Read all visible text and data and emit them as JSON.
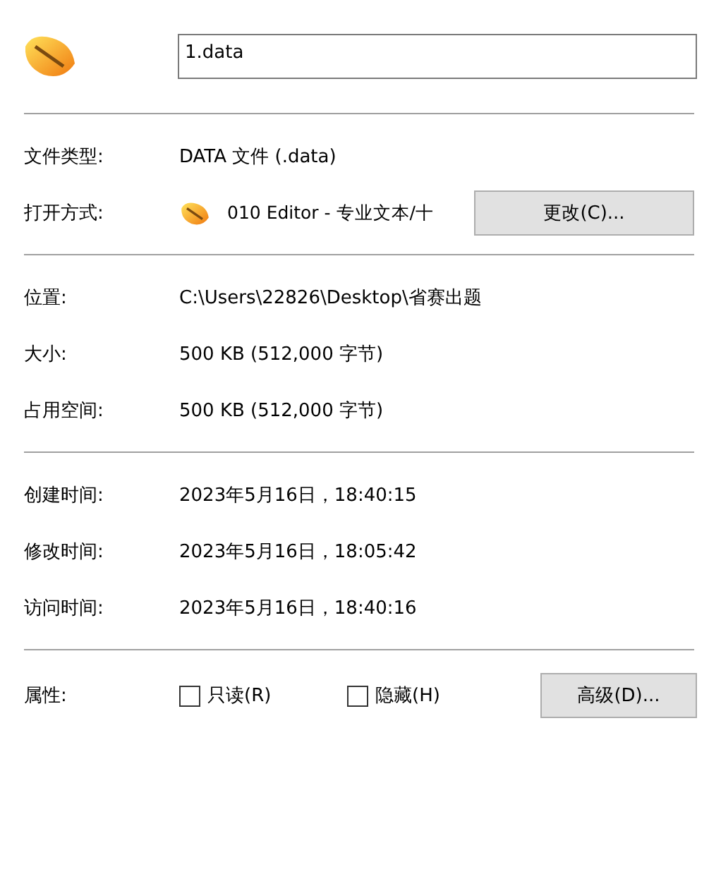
{
  "file_name": "1.data",
  "groups": [
    [
      {
        "kind": "text",
        "label": "文件类型:",
        "value": "DATA 文件 (.data)"
      },
      {
        "kind": "app",
        "label": "打开方式:",
        "value": "010 Editor - 专业文本/十",
        "button": "更改(C)..."
      }
    ],
    [
      {
        "kind": "text",
        "label": "位置:",
        "value": "C:\\Users\\22826\\Desktop\\省赛出题"
      },
      {
        "kind": "text",
        "label": "大小:",
        "value": "500 KB (512,000 字节)"
      },
      {
        "kind": "text",
        "label": "占用空间:",
        "value": "500 KB (512,000 字节)"
      }
    ],
    [
      {
        "kind": "text",
        "label": "创建时间:",
        "value": "2023年5月16日，18:40:15"
      },
      {
        "kind": "text",
        "label": "修改时间:",
        "value": "2023年5月16日，18:05:42"
      },
      {
        "kind": "text",
        "label": "访问时间:",
        "value": "2023年5月16日，18:40:16"
      }
    ]
  ],
  "attributes": {
    "label": "属性:",
    "options": [
      {
        "label": "只读(R)",
        "checked": false
      },
      {
        "label": "隐藏(H)",
        "checked": false
      }
    ],
    "button": "高级(D)..."
  }
}
